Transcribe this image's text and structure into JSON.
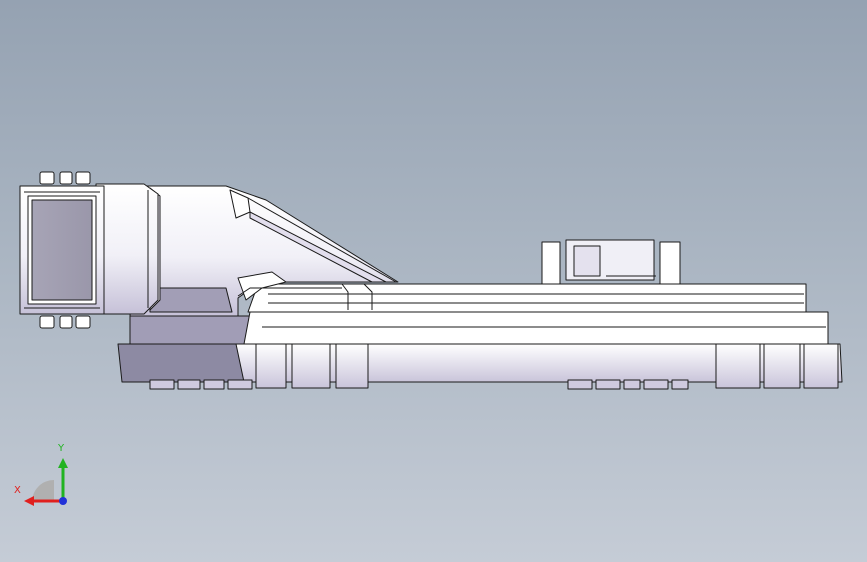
{
  "viewport": {
    "background_top": "#95a2b2",
    "background_bottom": "#c5ccd6"
  },
  "model": {
    "face_color": "#ffffff",
    "edge_color": "#1a1a1a",
    "shade_color": "#b8b2cc",
    "dark_color": "#8d8aa3"
  },
  "triad": {
    "x_label": "X",
    "y_label": "Y",
    "x_color": "#e0201e",
    "y_color": "#21b321",
    "z_color": "#2232d8"
  }
}
